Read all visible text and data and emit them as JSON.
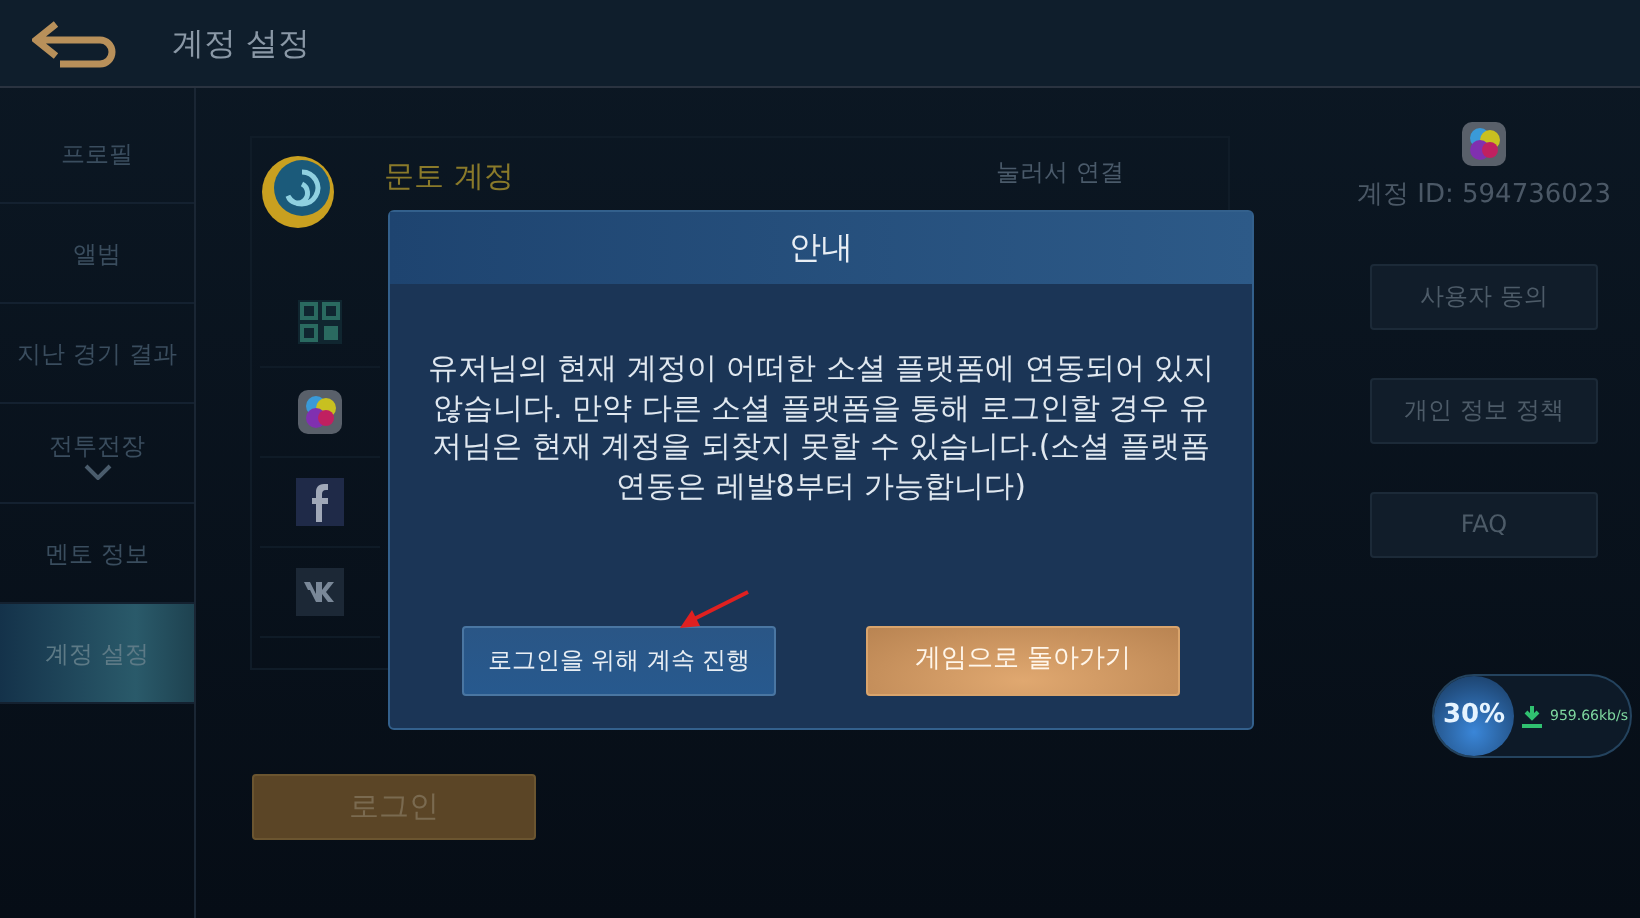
{
  "header": {
    "title": "계정 설정"
  },
  "sidebar": {
    "items": [
      {
        "label": "프로필",
        "selected": false,
        "kind": "link"
      },
      {
        "label": "앨범",
        "selected": false,
        "kind": "link"
      },
      {
        "label": "지난 경기 결과",
        "selected": false,
        "kind": "link"
      },
      {
        "label": "전투전장",
        "selected": false,
        "kind": "group"
      },
      {
        "label": "멘토 정보",
        "selected": false,
        "kind": "link"
      },
      {
        "label": "계정 설정",
        "selected": true,
        "kind": "link"
      }
    ]
  },
  "account_card": {
    "name": "문토 계정",
    "action": "눌러서 연결",
    "social_rows": [
      {
        "kind": "qr"
      },
      {
        "kind": "game"
      },
      {
        "kind": "facebook"
      },
      {
        "kind": "vk"
      }
    ]
  },
  "login_button": "로그인",
  "account_info": {
    "id": "계정 ID: 594736023",
    "buttons": [
      "사용자 동의",
      "개인 정보 정책",
      "FAQ"
    ]
  },
  "dialog": {
    "title": "안내",
    "message": "유저님의 현재 계정이 어떠한 소셜 플랫폼에 연동되어 있지 않습니다. 만약 다른 소셜 플랫폼을 통해 로그인할 경우 유저님은 현재 계정을 되찾지 못할 수 있습니다.(소셜 플랫폼 연동은 레발8부터 가능합니다)",
    "buttons": [
      {
        "label": "로그인을 위해 계속 진행",
        "kind": "secondary"
      },
      {
        "label": "게임으로 돌아가기",
        "kind": "primary"
      }
    ]
  },
  "download": {
    "percent": "30%",
    "speed": "959.66kb/s"
  }
}
